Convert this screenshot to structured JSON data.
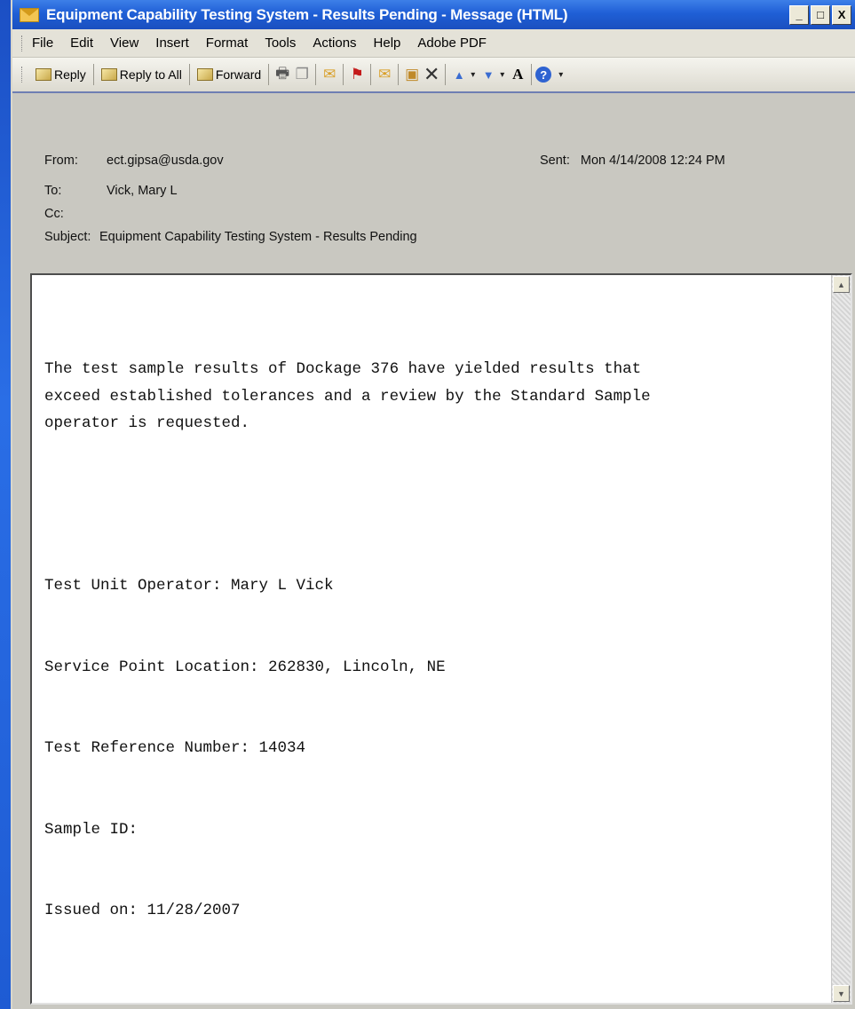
{
  "window": {
    "title": "Equipment Capability Testing System - Results Pending - Message (HTML)",
    "buttons": {
      "minimize": "_",
      "maximize": "□",
      "close": "X"
    }
  },
  "menu": [
    "File",
    "Edit",
    "View",
    "Insert",
    "Format",
    "Tools",
    "Actions",
    "Help",
    "Adobe PDF"
  ],
  "toolbar": {
    "reply": "Reply",
    "reply_all": "Reply to All",
    "forward": "Forward"
  },
  "header": {
    "from_label": "From:",
    "from_value": "ect.gipsa@usda.gov",
    "sent_label": "Sent:",
    "sent_value": "Mon 4/14/2008 12:24 PM",
    "to_label": "To:",
    "to_value": "Vick, Mary L",
    "cc_label": "Cc:",
    "cc_value": "",
    "subject_label": "Subject:",
    "subject_value": "Equipment Capability Testing System - Results Pending"
  },
  "message": {
    "paragraph": "The test sample results of Dockage 376 have yielded results that\nexceed established tolerances and a review by the Standard Sample\noperator is requested.",
    "lines": [
      "Test Unit Operator: Mary L Vick",
      "Service Point Location: 262830, Lincoln, NE",
      "Test Reference Number: 14034",
      "Sample ID:",
      "Issued on: 11/28/2007"
    ]
  },
  "colors": {
    "titlebar": "#1f5fd6",
    "desktop": "#2a6ee6",
    "chrome": "#c9c8c1"
  }
}
